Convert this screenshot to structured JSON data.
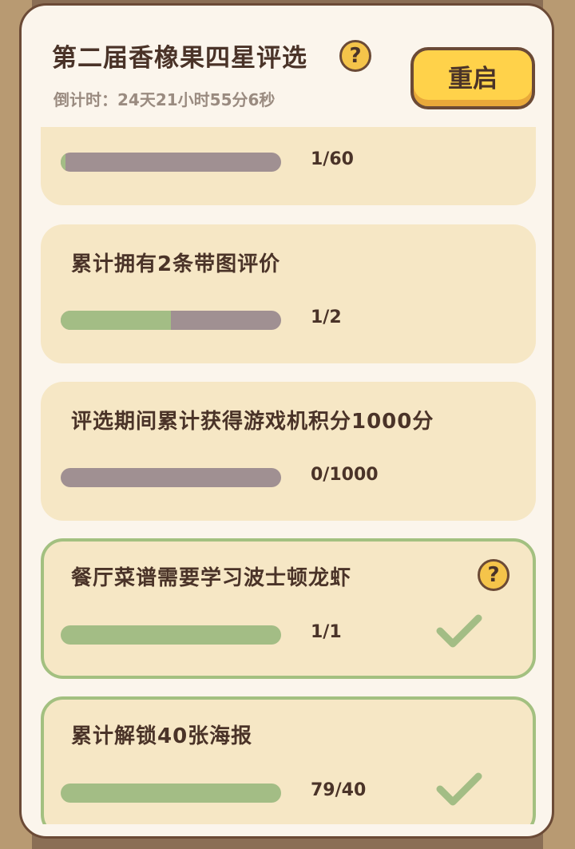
{
  "panel": {
    "title": "第二届香橡果四星评选",
    "help_symbol": "?",
    "countdown": "倒计时：24天21小时55分6秒",
    "restart_label": "重启"
  },
  "tasks": [
    {
      "label": "",
      "progress": "1/60",
      "fraction": 0.02,
      "completed": false
    },
    {
      "label": "累计拥有2条带图评价",
      "progress": "1/2",
      "fraction": 0.5,
      "completed": false
    },
    {
      "label": "评选期间累计获得游戏机积分1000分",
      "progress": "0/1000",
      "fraction": 0.0,
      "completed": false
    },
    {
      "label": "餐厅菜谱需要学习波士顿龙虾",
      "progress": "1/1",
      "fraction": 1.0,
      "completed": true,
      "has_help": true
    },
    {
      "label": "累计解锁40张海报",
      "progress": "79/40",
      "fraction": 1.0,
      "completed": true
    }
  ],
  "colors": {
    "panel_bg": "#fbf5ec",
    "card_bg": "#f6e7c5",
    "bar_empty": "#a09092",
    "bar_fill": "#a3bd85",
    "done_border": "#a3c080",
    "button_yellow": "#ffd24a",
    "text_dark": "#4a3328"
  }
}
